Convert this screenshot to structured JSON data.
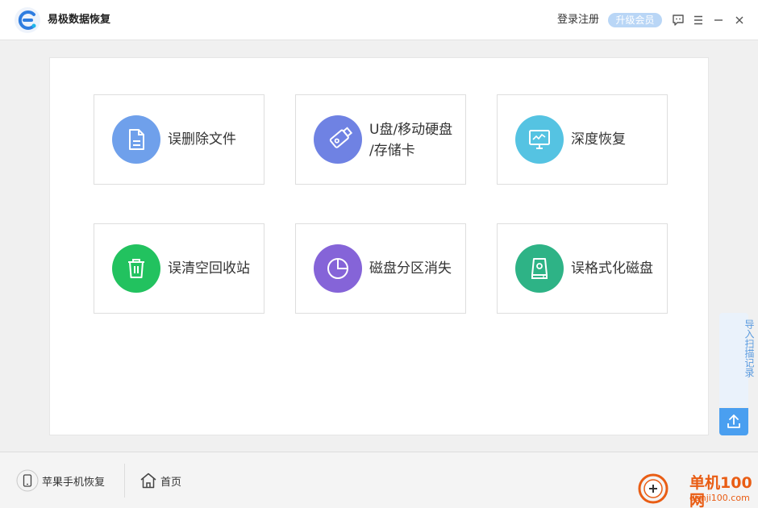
{
  "app": {
    "title": "易极数据恢复"
  },
  "header": {
    "login_label": "登录注册",
    "vip_label": "升级会员",
    "icons": [
      "feedback-icon",
      "menu-icon",
      "minimize-icon",
      "close-icon"
    ]
  },
  "cards": [
    {
      "label": "误删除文件",
      "icon": "file-icon",
      "color": "#6fa0eb"
    },
    {
      "label": "U盘/移动硬盘\n/存储卡",
      "line1": "U盘/移动硬盘",
      "line2": "/存储卡",
      "icon": "usb-icon",
      "color": "#6f82e3"
    },
    {
      "label": "深度恢复",
      "icon": "monitor-icon",
      "color": "#55c3e2"
    },
    {
      "label": "误清空回收站",
      "icon": "trash-icon",
      "color": "#22c25f"
    },
    {
      "label": "磁盘分区消失",
      "icon": "pie-chart-icon",
      "color": "#8564d8"
    },
    {
      "label": "误格式化磁盘",
      "icon": "disk-icon",
      "color": "#2eb386"
    }
  ],
  "side": {
    "import_label": "导入扫描记录"
  },
  "bottom": {
    "iphone_label": "苹果手机恢复",
    "home_label": "首页"
  },
  "watermark": {
    "line1": "单机100网",
    "line2": "danji100.com"
  }
}
